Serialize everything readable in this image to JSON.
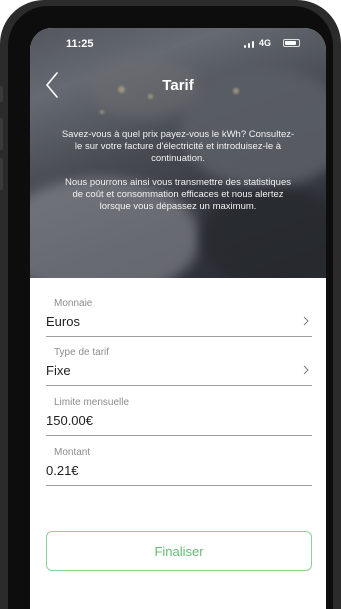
{
  "status_bar": {
    "time": "11:25",
    "network": "4G",
    "icons": [
      "signal-icon",
      "battery-icon"
    ]
  },
  "nav": {
    "title": "Tarif",
    "back_icon": "chevron-left-icon"
  },
  "intro": {
    "paragraph_1": "Savez-vous à quel prix payez-vous le kWh? Consultez-le sur votre facture d'électricité et introduisez-le à continuation.",
    "paragraph_2": "Nous pourrons ainsi vous transmettre des statistiques de coût et consommation efficaces et nous alertez lorsque vous dépassez un maximum."
  },
  "form": {
    "currency": {
      "label": "Monnaie",
      "value": "Euros",
      "icon": "chevron-right-icon"
    },
    "tariff_type": {
      "label": "Type de tarif",
      "value": "Fixe",
      "icon": "chevron-right-icon"
    },
    "monthly_limit": {
      "label": "Limite mensuelle",
      "value": "150.00€"
    },
    "amount": {
      "label": "Montant",
      "value": "0.21€"
    }
  },
  "actions": {
    "finalize_label": "Finaliser"
  },
  "colors": {
    "accent_green": "#66bb74",
    "button_border": "#8fcf98",
    "label_gray": "#8c8c8c",
    "divider": "#9e9e9e"
  }
}
